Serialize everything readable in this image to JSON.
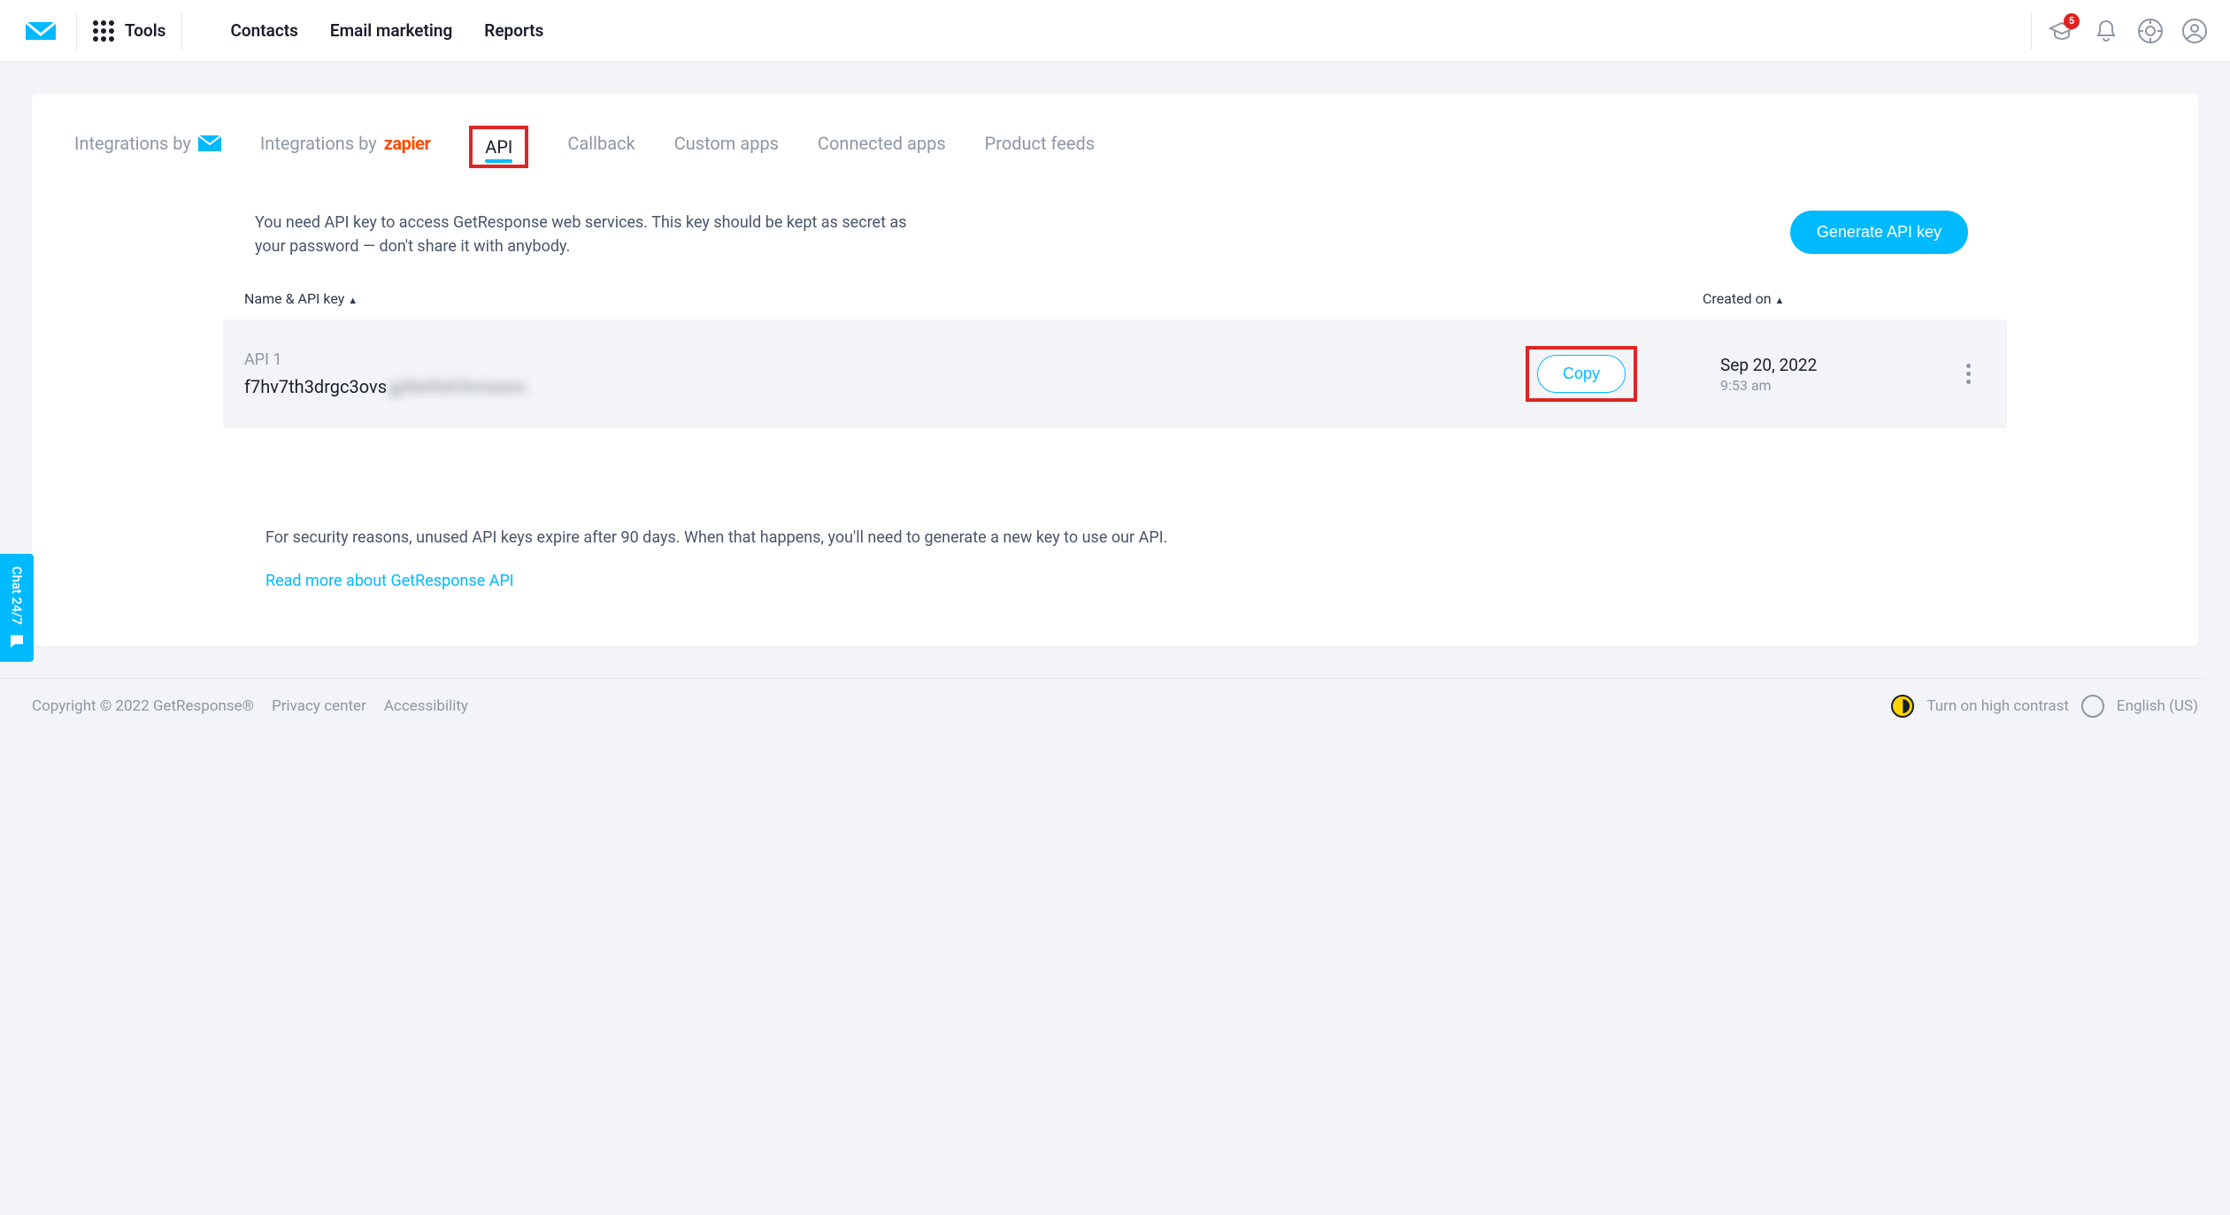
{
  "nav": {
    "tools": "Tools",
    "links": [
      "Contacts",
      "Email marketing",
      "Reports"
    ],
    "badge": "5"
  },
  "tabs": {
    "integrations_by": "Integrations by",
    "zapier": "zapier",
    "api": "API",
    "callback": "Callback",
    "custom_apps": "Custom apps",
    "connected_apps": "Connected apps",
    "product_feeds": "Product feeds"
  },
  "intro": {
    "text": "You need API key to access GetResponse web services. This key should be kept as secret as your password — don't share it with anybody.",
    "generate_btn": "Generate API key"
  },
  "table": {
    "col_name": "Name & API key",
    "col_created": "Created on",
    "row": {
      "name": "API 1",
      "key_visible": "f7hv7th3drgc3ovs",
      "key_hidden": "gj4le0lsh5mixesn",
      "copy": "Copy",
      "date": "Sep 20, 2022",
      "time": "9:53 am"
    }
  },
  "footnote": {
    "text": "For security reasons, unused API keys expire after 90 days. When that happens, you'll need to generate a new key to use our API.",
    "link": "Read more about GetResponse API"
  },
  "footer": {
    "copyright": "Copyright © 2022 GetResponse®",
    "privacy": "Privacy center",
    "accessibility": "Accessibility",
    "contrast": "Turn on high contrast",
    "language": "English (US)"
  },
  "chat": "Chat 24/7"
}
